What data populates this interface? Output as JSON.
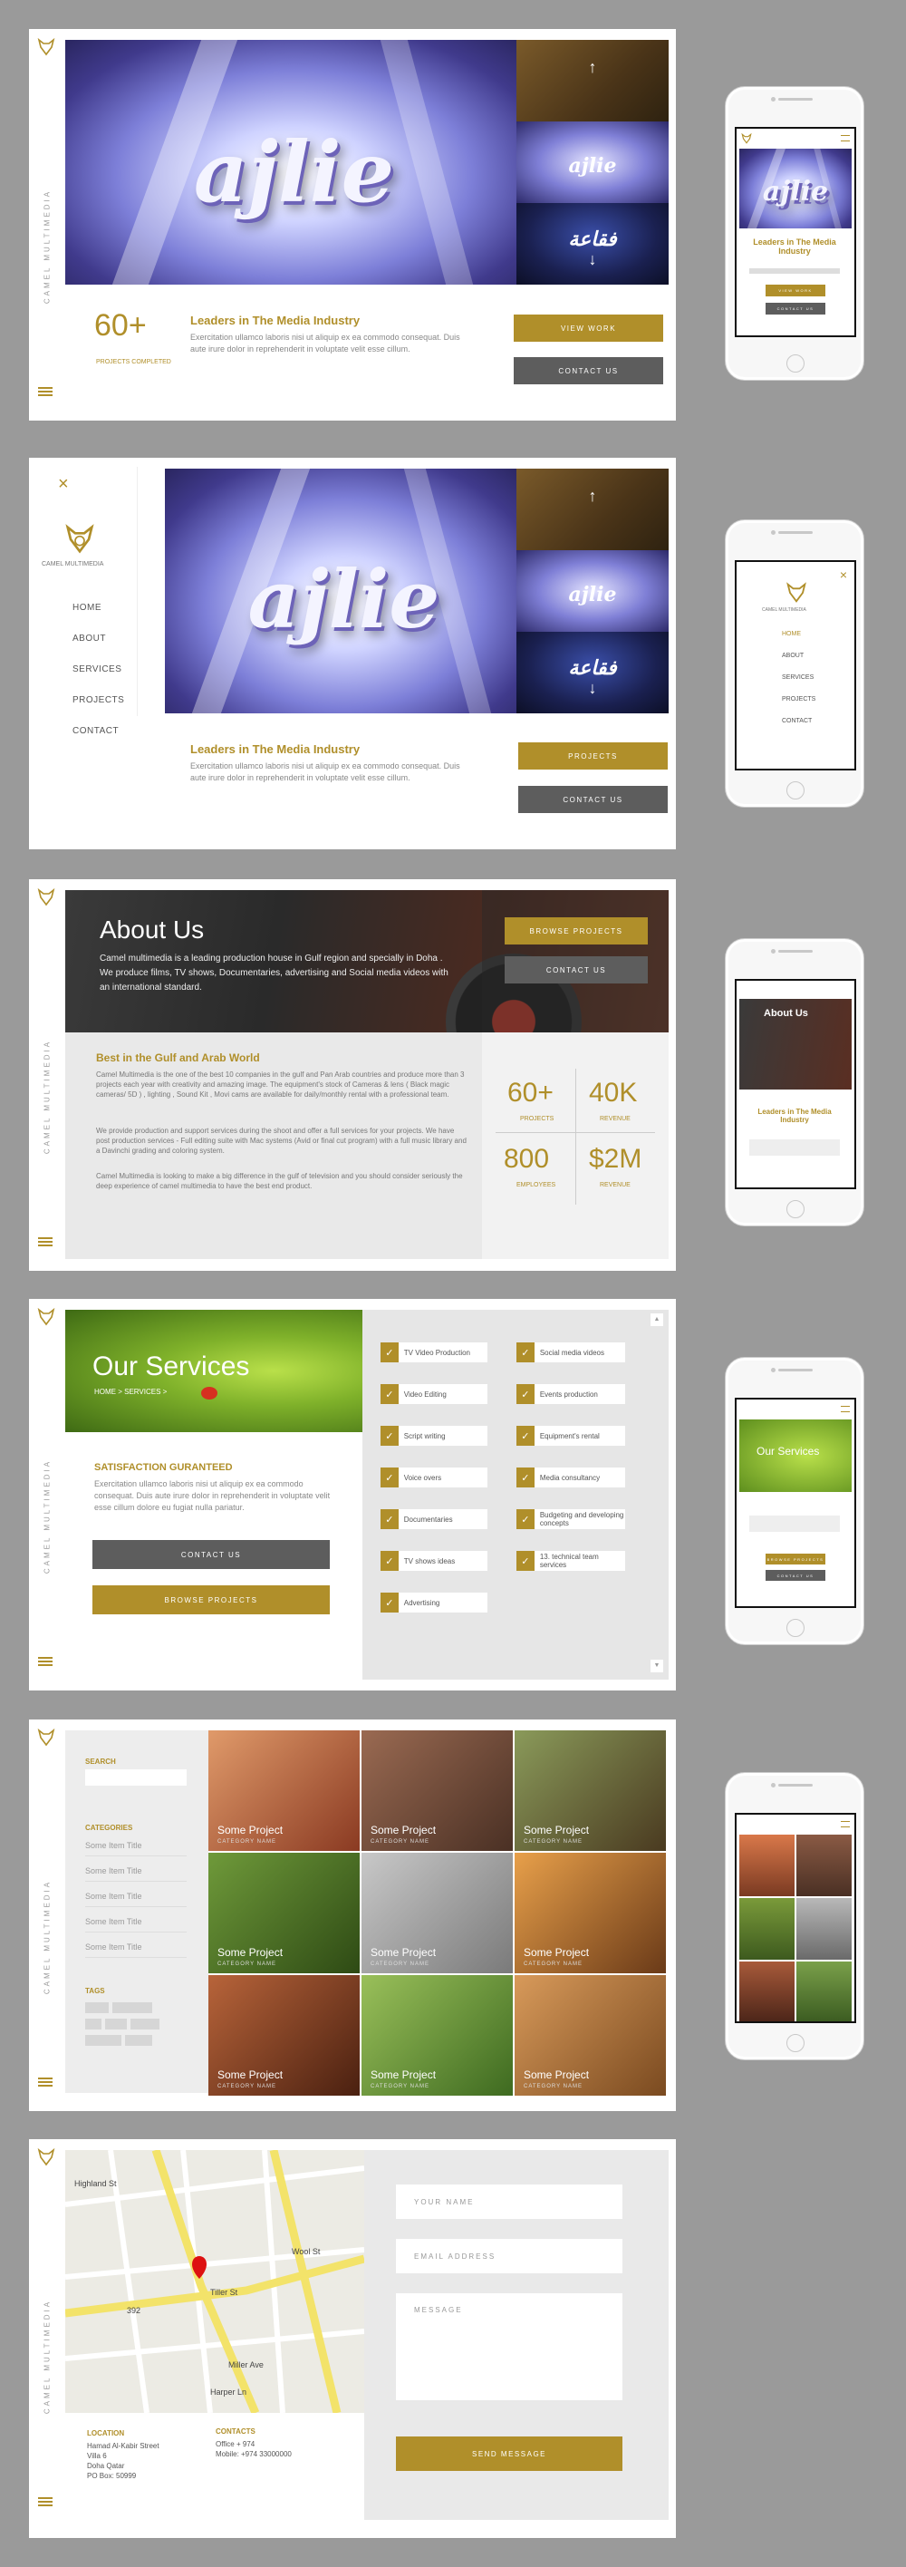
{
  "brand": {
    "vertical": "CAMEL MULTIMEDIA",
    "name": "CAMEL MULTIMEDIA",
    "accent": "#b08f2a",
    "dark_button": "#5d5d5d"
  },
  "hero": {
    "word": "ajlie",
    "stat_value": "60+",
    "stat_label": "PROJECTS COMPLETED",
    "heading": "Leaders in The Media Industry",
    "body": "Exercitation ullamco laboris nisi ut aliquip ex ea commodo consequat. Duis aute irure dolor in reprehenderit in voluptate velit esse cillum.",
    "view_work": "VIEW WORK",
    "contact_us": "CONTACT US",
    "projects": "PROJECTS"
  },
  "menu": {
    "close": "×",
    "items": [
      "HOME",
      "ABOUT",
      "SERVICES",
      "PROJECTS",
      "CONTACT"
    ]
  },
  "about": {
    "title": "About Us",
    "intro": "Camel multimedia is a leading production house in Gulf region and specially in Doha . We produce films, TV shows, Documentaries, advertising and Social media videos with an international standard.",
    "browse": "BROWSE PROJECTS",
    "contact": "CONTACT US",
    "heading": "Best in the Gulf and Arab World",
    "p1": "Camel Multimedia is the one of the best 10 companies in the gulf and Pan Arab countries and produce more than 3 projects each year with creativity and amazing image. The equipment's stock of Cameras & lens ( Black magic cameras/ 5D ) , lighting , Sound Kit , Movi cams are available for daily/monthly rental with a professional team.",
    "p2": "We provide production and support services during the shoot and offer a full services for your projects. We have post production services - Full editing suite with Mac systems (Avid or final cut program) with a full music library and a Davinchi grading and coloring system.",
    "p3": "Camel Multimedia is looking to make a big difference in the gulf of television and you should consider seriously the deep experience of camel multimedia to have the best end product.",
    "stats": [
      {
        "value": "60+",
        "label": "PROJECTS"
      },
      {
        "value": "40K",
        "label": "REVENUE"
      },
      {
        "value": "800",
        "label": "EMPLOYEES"
      },
      {
        "value": "$2M",
        "label": "REVENUE"
      }
    ]
  },
  "services": {
    "title": "Our Services",
    "breadcrumb": "HOME > SERVICES >",
    "heading": "SATISFACTION GURANTEED",
    "body": "Exercitation ullamco laboris nisi ut aliquip ex ea commodo consequat. Duis aute irure dolor in reprehenderit in voluptate velit esse cillum dolore eu fugiat nulla pariatur.",
    "contact": "CONTACT US",
    "browse": "BROWSE PROJECTS",
    "left": [
      "TV Video Production",
      "Video Editing",
      "Script writing",
      "Voice overs",
      "Documentaries",
      "TV shows ideas",
      "Advertising"
    ],
    "right": [
      "Social media videos",
      "Events production",
      "Equipment's rental",
      "Media consultancy",
      "Budgeting and developing concepts",
      "13. technical team services"
    ]
  },
  "projects": {
    "search_label": "SEARCH",
    "categories_label": "CATEGORIES",
    "categories": [
      "Some Item Title",
      "Some Item Title",
      "Some Item Title",
      "Some Item Title",
      "Some Item Title"
    ],
    "tags_label": "TAGS",
    "tile_title": "Some Project",
    "tile_cat": "CATEGORY NAME"
  },
  "contact": {
    "name_ph": "YOUR NAME",
    "email_ph": "EMAIL ADDRESS",
    "message_ph": "MESSAGE",
    "send": "SEND MESSAGE",
    "location_label": "LOCATION",
    "location_lines": [
      "Hamad Al-Kabir Street",
      "Villa 6",
      "Doha Qatar",
      "PO Box: 50999"
    ],
    "contacts_label": "CONTACTS",
    "contacts_lines": [
      "Office + 974",
      "Mobile: +974 33000000"
    ],
    "map_labels": [
      "Harper Ln",
      "Tiller St",
      "Wool St",
      "Miller Ave",
      "Highland St",
      "392"
    ]
  },
  "mobile": {
    "leaders": "Leaders in The Media Industry",
    "about": "About Us",
    "services": "Our Services"
  }
}
